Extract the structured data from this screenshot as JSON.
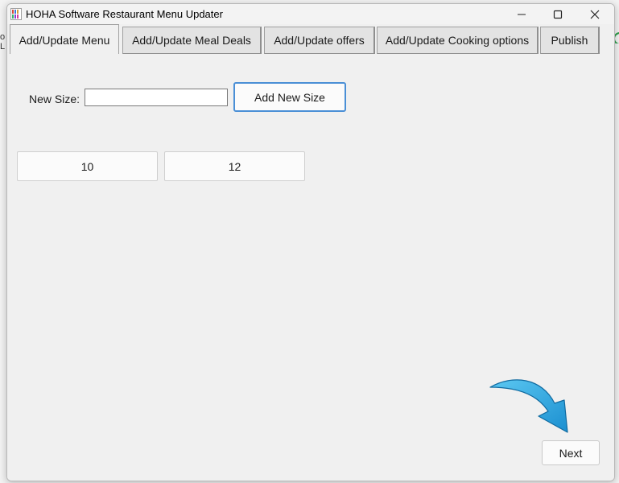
{
  "window": {
    "title": "HOHA Software Restaurant Menu Updater",
    "app_icon": "hoha-app-icon",
    "controls": [
      "minimize-icon",
      "maximize-icon",
      "close-icon"
    ]
  },
  "background_app": {
    "left_edge_text": "o L",
    "right_edge_icon": "green-circle-icon"
  },
  "tabs": [
    {
      "label": "Add/Update Menu",
      "active": true
    },
    {
      "label": "Add/Update Meal Deals",
      "active": false
    },
    {
      "label": "Add/Update offers",
      "active": false
    },
    {
      "label": "Add/Update Cooking options",
      "active": false
    },
    {
      "label": "Publish",
      "active": false
    }
  ],
  "form": {
    "new_size_label": "New Size:",
    "new_size_value": "",
    "add_button_label": "Add New Size"
  },
  "sizes": [
    "10",
    "12"
  ],
  "footer": {
    "next_label": "Next",
    "annotation_icon": "blue-curved-arrow-icon"
  },
  "colors": {
    "accent_border": "#4a8fd6",
    "arrow_blue": "#2aa6e0",
    "window_bg": "#f0f0f0"
  }
}
